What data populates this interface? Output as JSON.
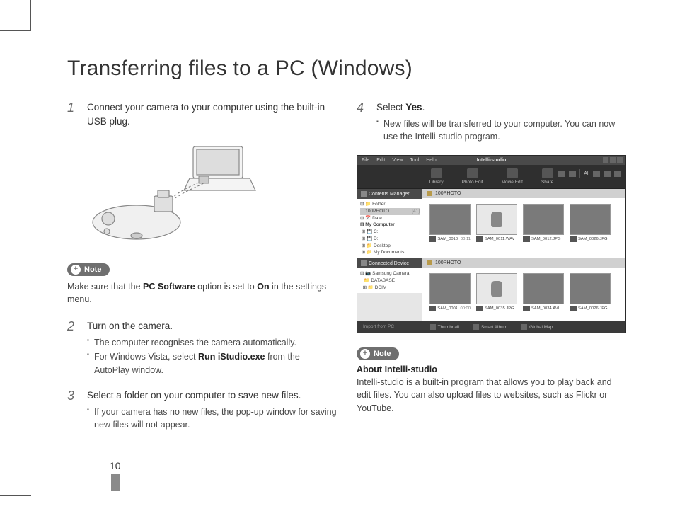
{
  "page_number": "10",
  "title": "Transferring files to a PC (Windows)",
  "steps": {
    "s1": {
      "num": "1",
      "text": "Connect your camera to your computer using the built-in USB plug."
    },
    "s2": {
      "num": "2",
      "text": "Turn on the camera.",
      "b1": "The computer recognises the camera automatically.",
      "b2_pre": "For Windows Vista, select ",
      "b2_bold": "Run iStudio.exe",
      "b2_post": " from the AutoPlay window."
    },
    "s3": {
      "num": "3",
      "text": "Select a folder on your computer to save new files.",
      "b1": "If your camera has no new files, the pop-up window for saving new files will not appear."
    },
    "s4": {
      "num": "4",
      "text_pre": "Select ",
      "text_bold": "Yes",
      "text_post": ".",
      "b1": "New files will be transferred to your computer. You can now use the Intelli-studio program."
    }
  },
  "note1": {
    "label": "Note",
    "pre": "Make sure that the ",
    "bold1": "PC Software",
    "mid": " option is set to ",
    "bold2": "On",
    "post": " in the settings menu."
  },
  "note2": {
    "label": "Note",
    "title": "About Intelli-studio",
    "text": "Intelli-studio is a built-in program that allows you to play back and edit files. You can also upload files to websites, such as Flickr or YouTube."
  },
  "app": {
    "title": "Intelli-studio",
    "menu": {
      "m0": "File",
      "m1": "Edit",
      "m2": "View",
      "m3": "Tool",
      "m4": "Help"
    },
    "modes": {
      "m0": "Library",
      "m1": "Photo Edit",
      "m2": "Movie Edit",
      "m3": "Share"
    },
    "right_all": "All",
    "sections": {
      "contents": "Contents Manager",
      "connected": "Connected Device"
    },
    "tree_top": {
      "folder": "Folder",
      "photo": "100PHOTO",
      "photo_count": "[41]",
      "date": "Date",
      "mycomp": "My Computer",
      "c": "C:",
      "d": "D:",
      "desktop": "Desktop",
      "docs": "My Documents"
    },
    "tree_bot": {
      "camera": "Samsung Camera",
      "db": "DATABASE",
      "dcim": "DCIM"
    },
    "crumb": "100PHOTO",
    "thumbs_top": {
      "t0": {
        "name": "SAM_0010.",
        "dur": "00:11"
      },
      "t1": {
        "name": "SAM_0011.WAV"
      },
      "t2": {
        "name": "SAM_0012.JPG"
      },
      "t3": {
        "name": "SAM_0026.JPG"
      }
    },
    "thumbs_bot": {
      "t0": {
        "name": "SAM_0004.",
        "dur": "00:00"
      },
      "t1": {
        "name": "SAM_0035.JPG"
      },
      "t2": {
        "name": "SAM_0034.AVI"
      },
      "t3": {
        "name": "SAM_0026.JPG"
      }
    },
    "footer": {
      "left": "Import from PC",
      "b0": "Thumbnail",
      "b1": "Smart Album",
      "b2": "Global Map"
    }
  }
}
